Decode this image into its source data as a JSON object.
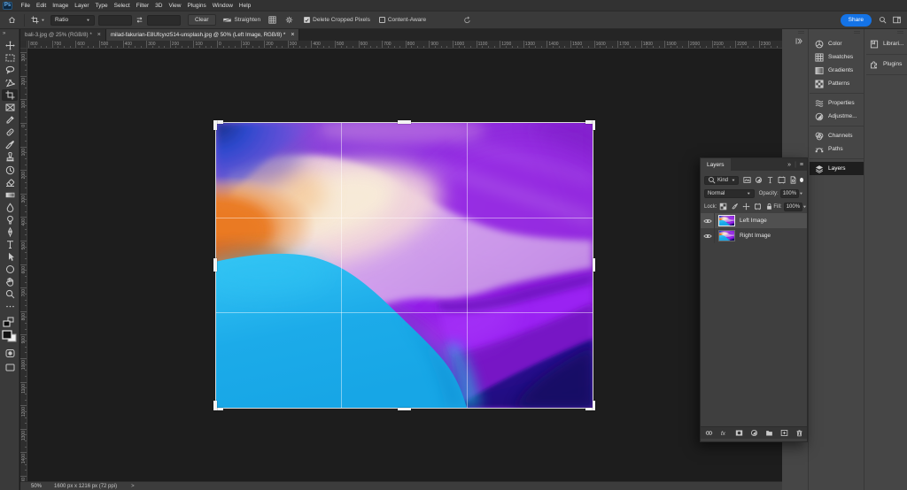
{
  "menu_bar": {
    "logo_text": "Ps",
    "items": [
      "File",
      "Edit",
      "Image",
      "Layer",
      "Type",
      "Select",
      "Filter",
      "3D",
      "View",
      "Plugins",
      "Window",
      "Help"
    ]
  },
  "options_bar": {
    "ratio_label": "Ratio",
    "width_value": "",
    "height_value": "",
    "clear_label": "Clear",
    "straighten_label": "Straighten",
    "delete_cropped": {
      "label": "Delete Cropped Pixels",
      "checked": true
    },
    "content_aware": {
      "label": "Content-Aware",
      "checked": false
    },
    "share_label": "Share",
    "accent_blue": "#1473e6"
  },
  "document_tabs": [
    {
      "title": "bali-3.jpg @ 25% (RGB/8) *",
      "active": false
    },
    {
      "title": "milad-fakurian-E8Ufcyxz514-unsplash.jpg @ 50% (Left Image, RGB/8) *",
      "active": true
    }
  ],
  "toolbar": {
    "tools": [
      {
        "name": "move"
      },
      {
        "name": "marquee"
      },
      {
        "name": "lasso"
      },
      {
        "name": "object-selection"
      },
      {
        "name": "crop",
        "selected": true
      },
      {
        "name": "frame"
      },
      {
        "name": "eyedropper"
      },
      {
        "name": "healing"
      },
      {
        "name": "brush"
      },
      {
        "name": "clone-stamp"
      },
      {
        "name": "history-brush"
      },
      {
        "name": "eraser"
      },
      {
        "name": "gradient"
      },
      {
        "name": "blur"
      },
      {
        "name": "dodge"
      },
      {
        "name": "pen"
      },
      {
        "name": "type"
      },
      {
        "name": "path-select"
      },
      {
        "name": "shape"
      },
      {
        "name": "hand"
      },
      {
        "name": "zoom"
      },
      {
        "name": "ellipsis"
      }
    ]
  },
  "rulers": {
    "horizontal_labels": [
      "800",
      "700",
      "600",
      "500",
      "400",
      "300",
      "200",
      "100",
      "0",
      "100",
      "200",
      "300",
      "400",
      "500",
      "600",
      "700",
      "800",
      "900",
      "1000",
      "1100",
      "1200",
      "1300",
      "1400",
      "1500",
      "1600",
      "1700",
      "1800",
      "1900",
      "2000",
      "2100",
      "2200",
      "2300"
    ],
    "vertical_labels": [
      "300",
      "200",
      "100",
      "0",
      "100",
      "200",
      "300",
      "400",
      "500",
      "600",
      "700",
      "800",
      "900",
      "1000",
      "1100",
      "1200",
      "1300",
      "1400",
      "1500"
    ]
  },
  "dock": {
    "panel_groups": [
      [
        {
          "label": "Color",
          "icon": "color"
        },
        {
          "label": "Swatches",
          "icon": "swatches"
        },
        {
          "label": "Gradients",
          "icon": "gradients"
        },
        {
          "label": "Patterns",
          "icon": "patterns"
        }
      ],
      [
        {
          "label": "Properties",
          "icon": "properties"
        },
        {
          "label": "Adjustme...",
          "icon": "adjustments"
        }
      ],
      [
        {
          "label": "Channels",
          "icon": "channels"
        },
        {
          "label": "Paths",
          "icon": "paths"
        }
      ],
      [
        {
          "label": "Layers",
          "icon": "layers",
          "selected": true
        }
      ]
    ],
    "right_column": [
      {
        "label": "Librari...",
        "icon": "libraries"
      },
      {
        "label": "Plugins",
        "icon": "plugins"
      }
    ]
  },
  "layers_panel": {
    "title": "Layers",
    "kind_label": "Kind",
    "blend_mode": "Normal",
    "opacity_label": "Opacity:",
    "opacity_value": "100%",
    "lock_label": "Lock:",
    "fill_label": "Fill:",
    "fill_value": "100%",
    "layers": [
      {
        "name": "Left Image",
        "selected": true,
        "visible": true
      },
      {
        "name": "Right Image",
        "selected": false,
        "visible": true
      }
    ]
  },
  "glyphs": {
    "tab_close": "×",
    "panel_collapse": "»",
    "panel_menu": "≡",
    "toolbar_expand": "»",
    "chevron_down": "▼",
    "divider": "|"
  },
  "status_bar": {
    "zoom_value": "50%",
    "doc_info": "1600 px x 1216 px (72 ppi)",
    "chevron": ">"
  },
  "artwork": {
    "description": "abstract wavy gradient wallpaper",
    "palette": [
      "#2b49d8",
      "#8c2ede",
      "#f3dfca",
      "#ef8830",
      "#22b4ec",
      "#9229e8",
      "#2a1390"
    ]
  }
}
